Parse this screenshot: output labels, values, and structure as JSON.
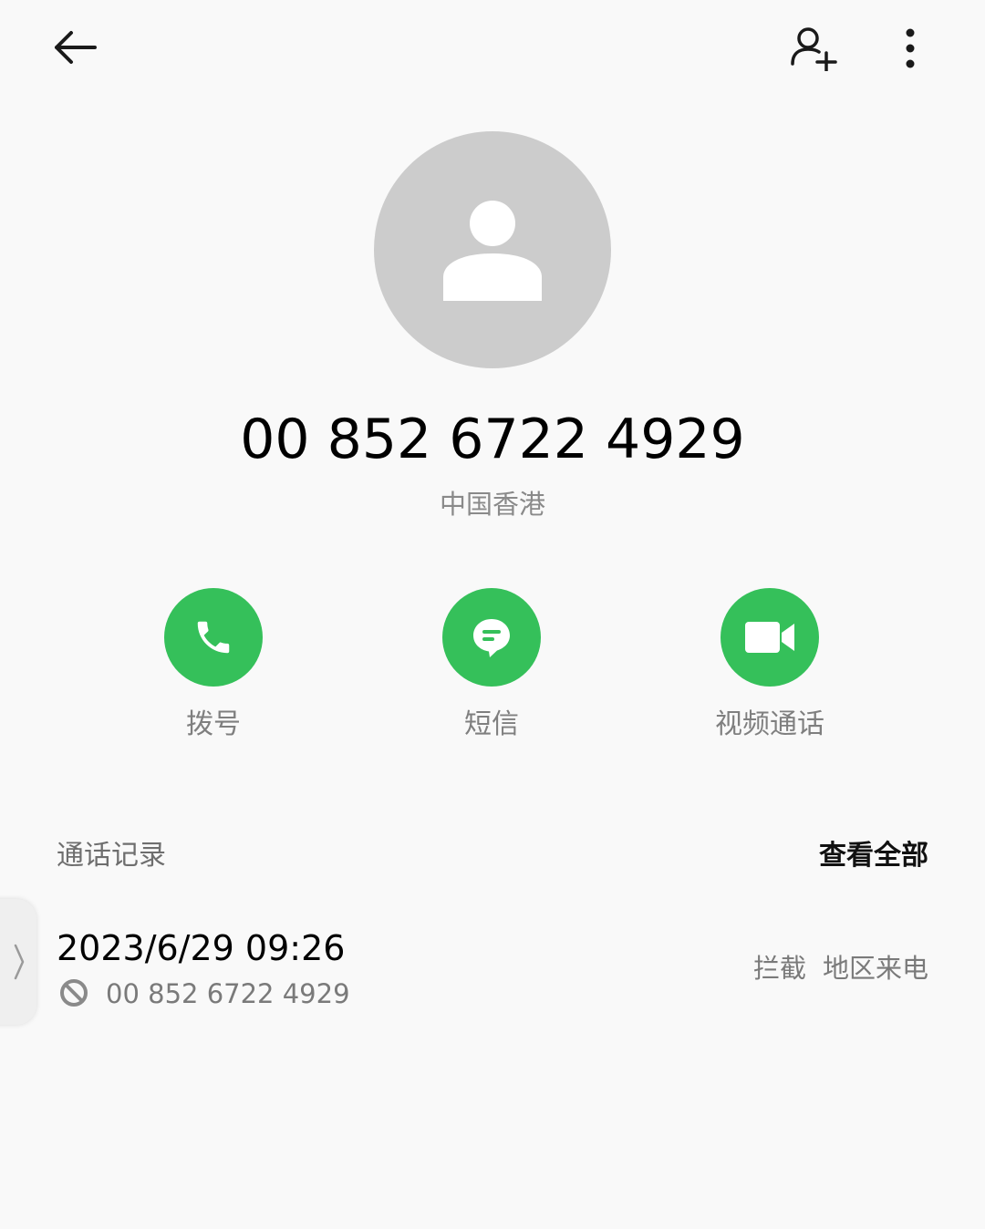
{
  "contact": {
    "phone_number": "00 852 6722 4929",
    "region": "中国香港"
  },
  "actions": {
    "call_label": "拨号",
    "sms_label": "短信",
    "video_label": "视频通话"
  },
  "call_log": {
    "title": "通话记录",
    "view_all": "查看全部",
    "entries": [
      {
        "datetime": "2023/6/29 09:26",
        "number": "00 852 6722 4929",
        "status": "拦截",
        "type": "地区来电"
      }
    ]
  },
  "colors": {
    "accent": "#35c05a",
    "avatar_bg": "#cccccc",
    "background": "#f9f9f9"
  },
  "icons": {
    "back": "back-arrow-icon",
    "add_contact": "add-person-icon",
    "more": "more-vertical-icon",
    "avatar": "person-silhouette-icon",
    "call": "phone-icon",
    "sms": "message-icon",
    "video": "video-camera-icon",
    "blocked": "blocked-icon",
    "handle": "chevron-right-icon"
  }
}
